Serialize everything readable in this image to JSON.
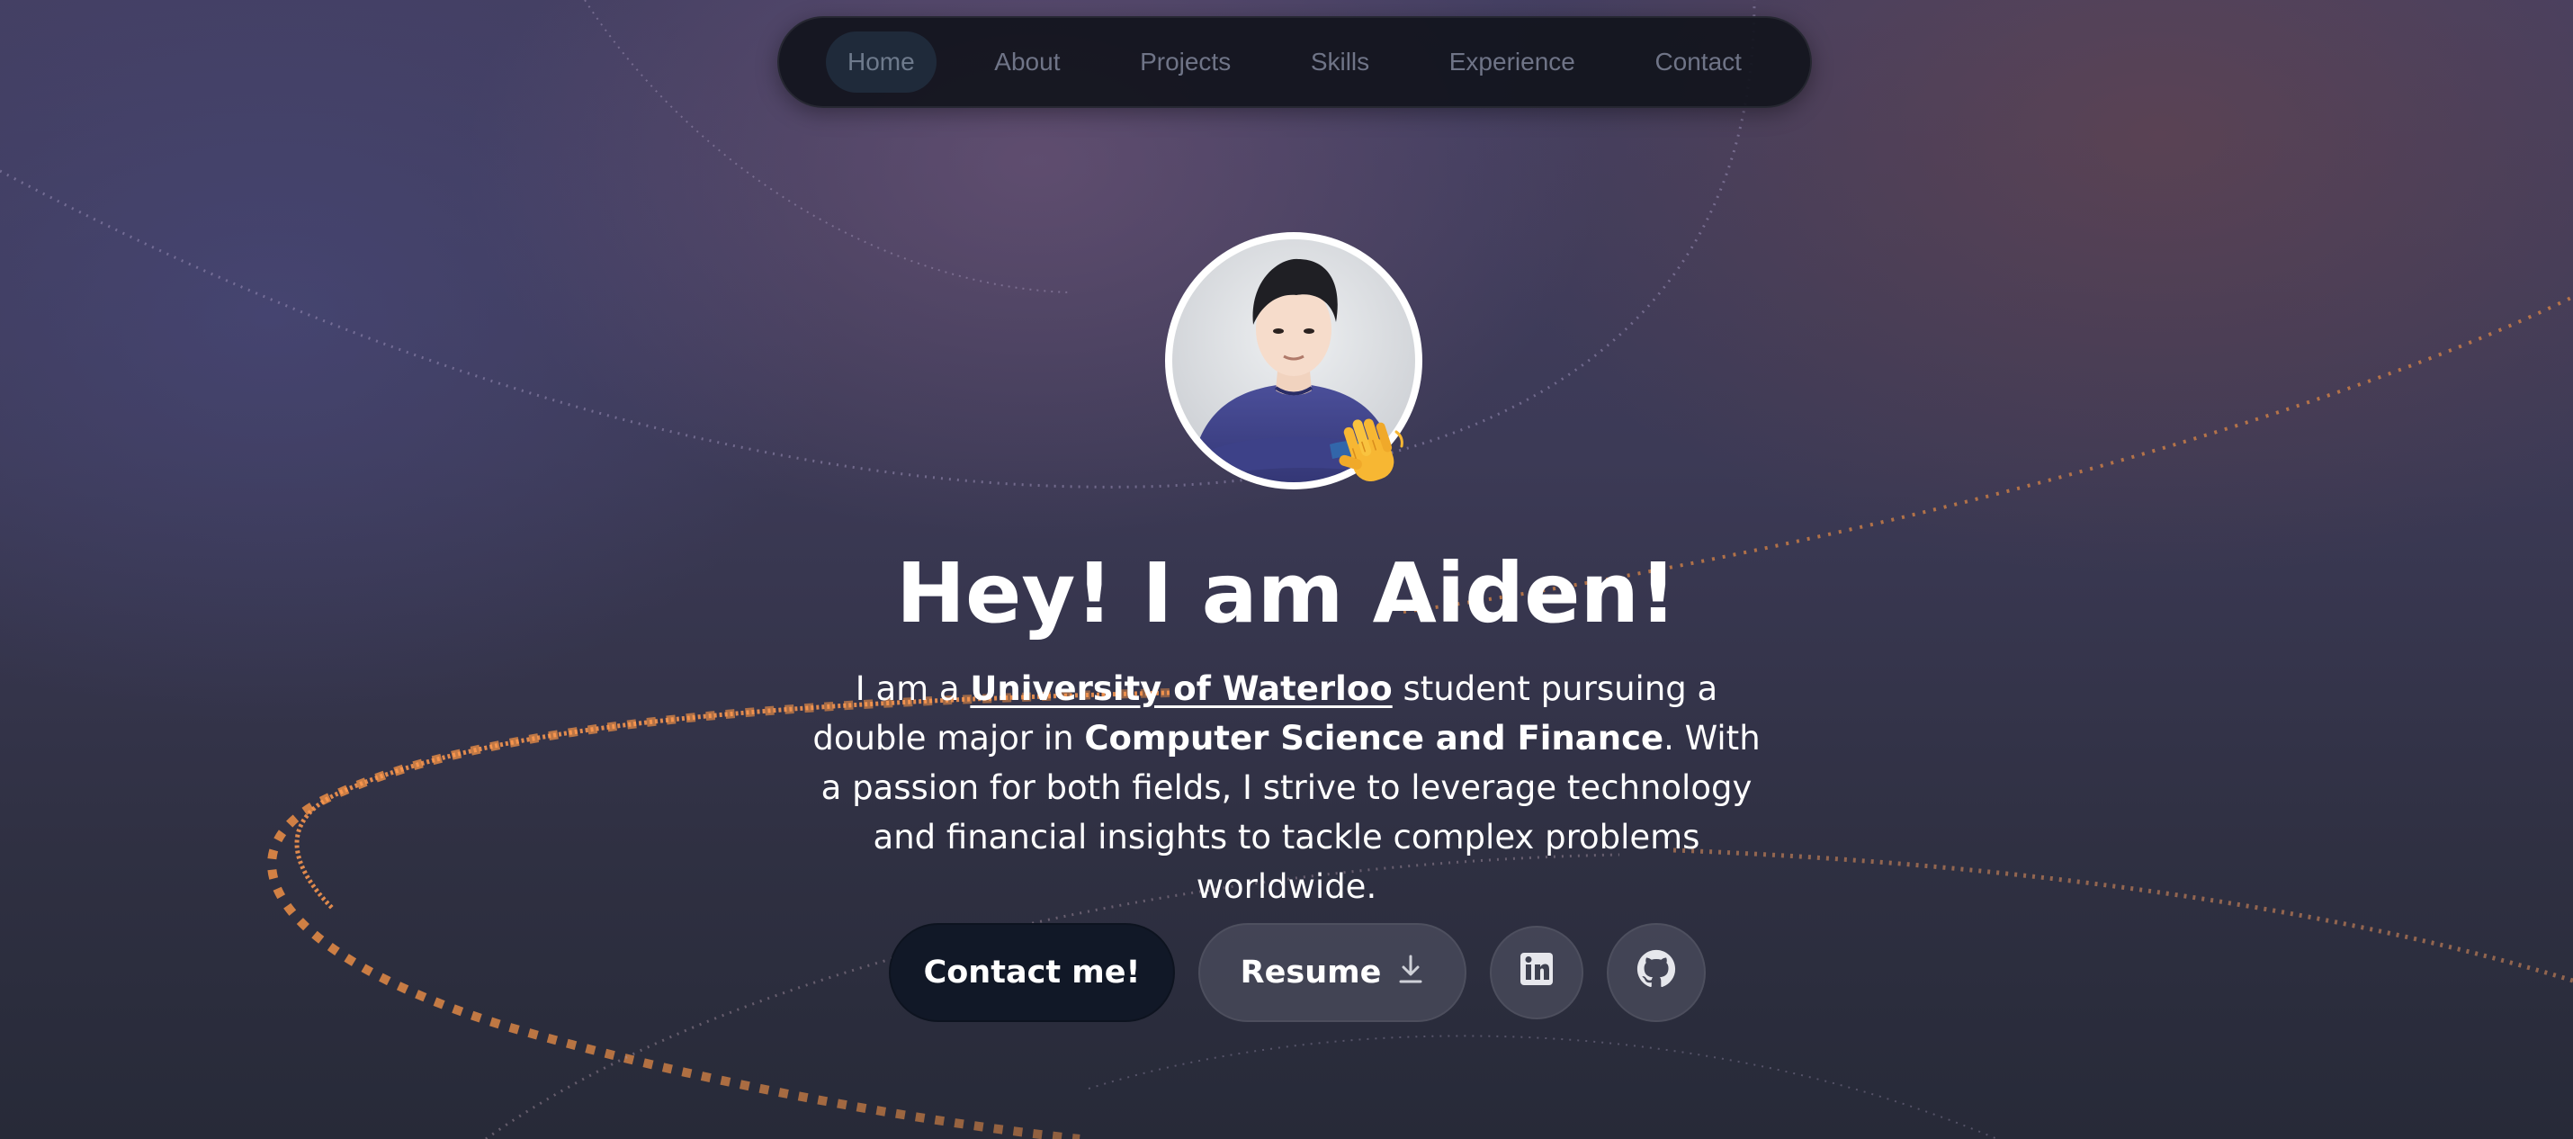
{
  "nav": {
    "items": [
      {
        "label": "Home",
        "active": true
      },
      {
        "label": "About"
      },
      {
        "label": "Projects"
      },
      {
        "label": "Skills"
      },
      {
        "label": "Experience"
      },
      {
        "label": "Contact"
      }
    ]
  },
  "hero": {
    "avatar_icon": "profile-photo",
    "wave_icon": "waving-hand-emoji",
    "title": "Hey! I am Aiden!",
    "intro": {
      "part1": "I am a ",
      "university": "University of Waterloo",
      "part2": " student pursuing a double major in ",
      "majors": "Computer Science and Finance",
      "part3": ". With a passion for both fields, I strive to leverage technology and financial insights to tackle complex problems worldwide."
    }
  },
  "buttons": {
    "contact_label": "Contact me!",
    "resume_label": "Resume",
    "resume_icon": "download-icon",
    "linkedin_icon": "linkedin-icon",
    "github_icon": "github-icon"
  },
  "colors": {
    "accent_orange": "#e48a45",
    "nav_bg": "#11131c",
    "contact_bg": "#111827"
  }
}
